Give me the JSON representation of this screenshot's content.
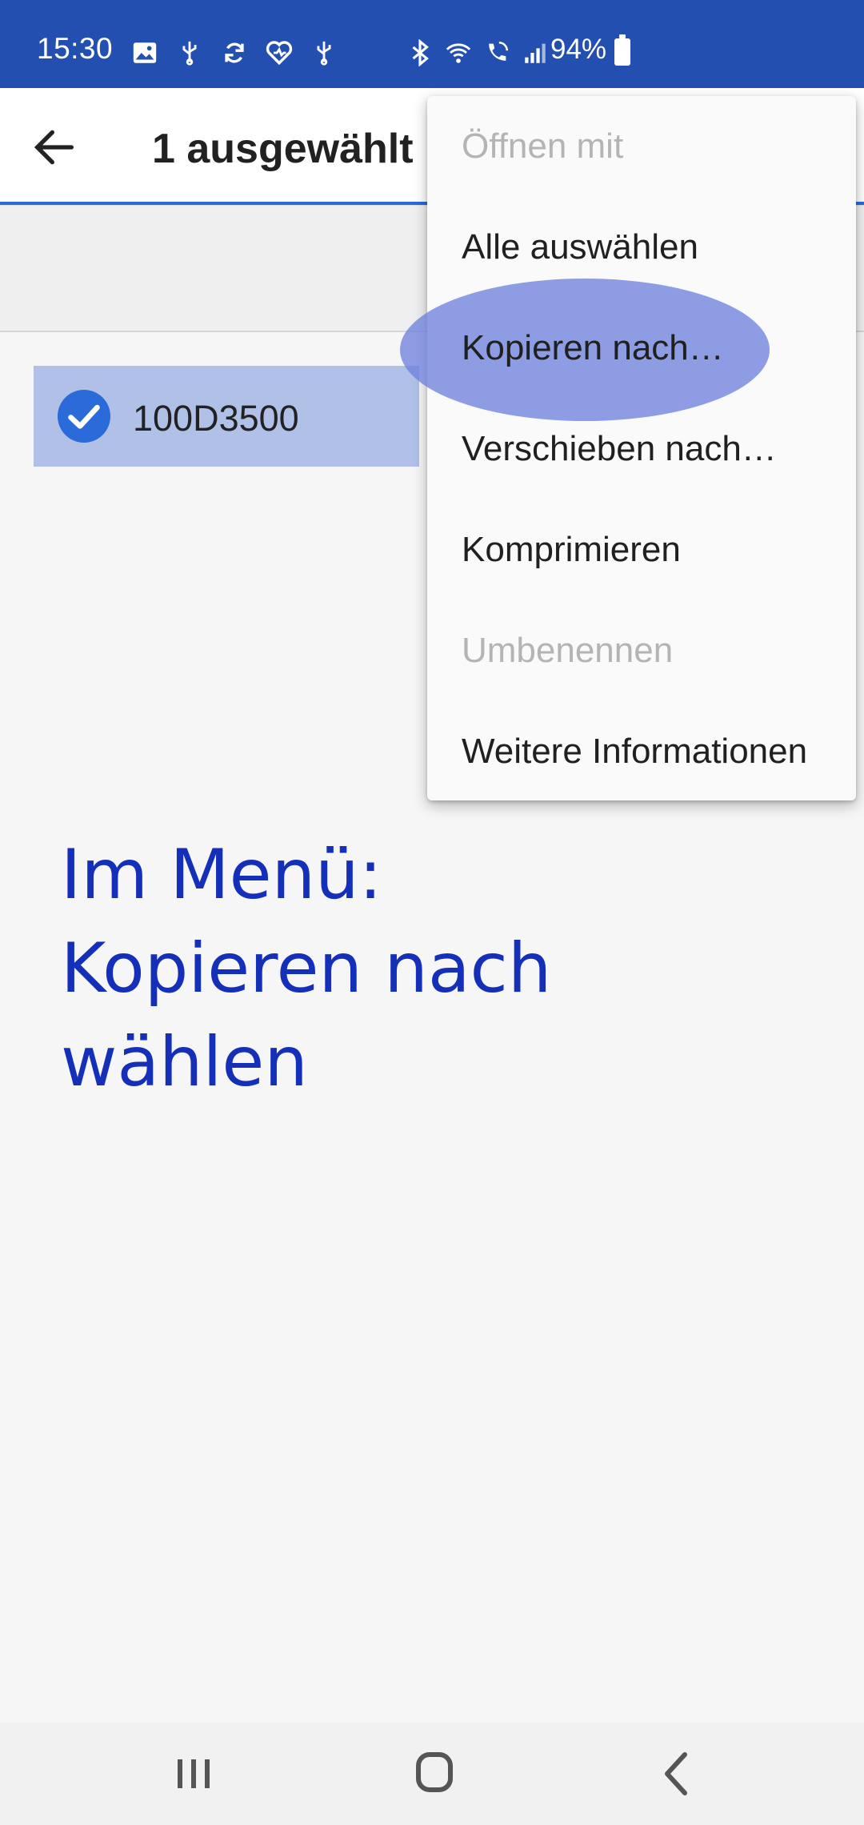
{
  "status_bar": {
    "time": "15:30",
    "battery": "94%",
    "left_icons": [
      "image-icon",
      "usb-icon",
      "sync-icon",
      "heart-icon",
      "usb-icon"
    ],
    "right_icons": [
      "bluetooth-icon",
      "wifi-icon",
      "wifi-calling-icon",
      "signal-icon",
      "battery-icon"
    ],
    "color": "#2350b0"
  },
  "app_bar": {
    "back_icon": "arrow-back-icon",
    "title": "1 ausgewählt",
    "accent": "#2a6bd9"
  },
  "selected_item": {
    "name": "100D3500",
    "icon": "check-circle-icon",
    "check_color": "#2a6bd9",
    "highlight_color": "#b0c0e6"
  },
  "overflow_menu": {
    "items": [
      {
        "label": "Öffnen mit",
        "enabled": false
      },
      {
        "label": "Alle auswählen",
        "enabled": true
      },
      {
        "label": "Kopieren nach…",
        "enabled": true,
        "highlighted": true
      },
      {
        "label": "Verschieben nach…",
        "enabled": true
      },
      {
        "label": "Komprimieren",
        "enabled": true
      },
      {
        "label": "Umbenennen",
        "enabled": false
      },
      {
        "label": "Weitere Informationen",
        "enabled": true
      }
    ]
  },
  "annotation": {
    "lines": [
      "Im Menü:",
      "Kopieren nach",
      "wählen"
    ],
    "color": "#1530b8"
  },
  "nav_bar": {
    "buttons": [
      "recent-apps-icon",
      "home-icon",
      "back-icon"
    ]
  }
}
